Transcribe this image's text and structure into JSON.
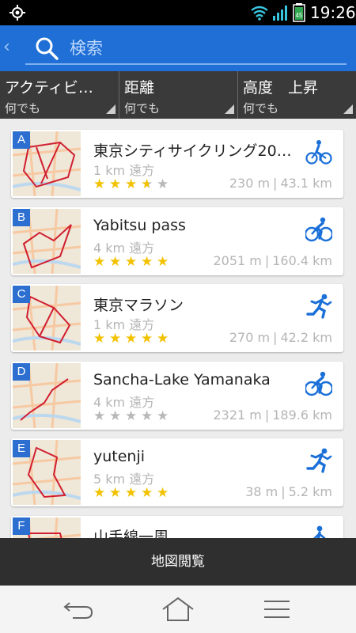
{
  "status": {
    "time": "19:26",
    "battery_level": "45"
  },
  "search": {
    "placeholder": "検索"
  },
  "filters": [
    {
      "label": "アクティビ…",
      "value": "何でも"
    },
    {
      "label": "距離",
      "value": "何でも"
    },
    {
      "label": "高度　上昇",
      "value": "何でも"
    }
  ],
  "routes": [
    {
      "letter": "A",
      "name": "東京シティサイクリング20…",
      "distance": "1 km 遠方",
      "rating": 3.5,
      "elevation": "230 m",
      "length": "43.1 km",
      "activity": "cycling"
    },
    {
      "letter": "B",
      "name": "Yabitsu pass",
      "distance": "4 km 遠方",
      "rating": 5,
      "elevation": "2051 m",
      "length": "160.4 km",
      "activity": "mountain-biking"
    },
    {
      "letter": "C",
      "name": "東京マラソン",
      "distance": "1 km 遠方",
      "rating": 5,
      "elevation": "270 m",
      "length": "42.2 km",
      "activity": "running"
    },
    {
      "letter": "D",
      "name": "Sancha-Lake Yamanaka",
      "distance": "4 km 遠方",
      "rating": 0,
      "elevation": "2321 m",
      "length": "189.6 km",
      "activity": "mountain-biking"
    },
    {
      "letter": "E",
      "name": "yutenji",
      "distance": "5 km 遠方",
      "rating": 5,
      "elevation": "38 m",
      "length": "5.2 km",
      "activity": "running"
    },
    {
      "letter": "F",
      "name": "山手線一周",
      "distance": "",
      "rating": 0,
      "elevation": "",
      "length": "",
      "activity": "walking"
    }
  ],
  "colors": {
    "accent": "#1f6fd6",
    "star_filled": "#f2c200",
    "star_empty": "#b8b8b8",
    "icon_blue": "#1a6fd8"
  },
  "bottom_action": {
    "label": "地図閲覧"
  }
}
